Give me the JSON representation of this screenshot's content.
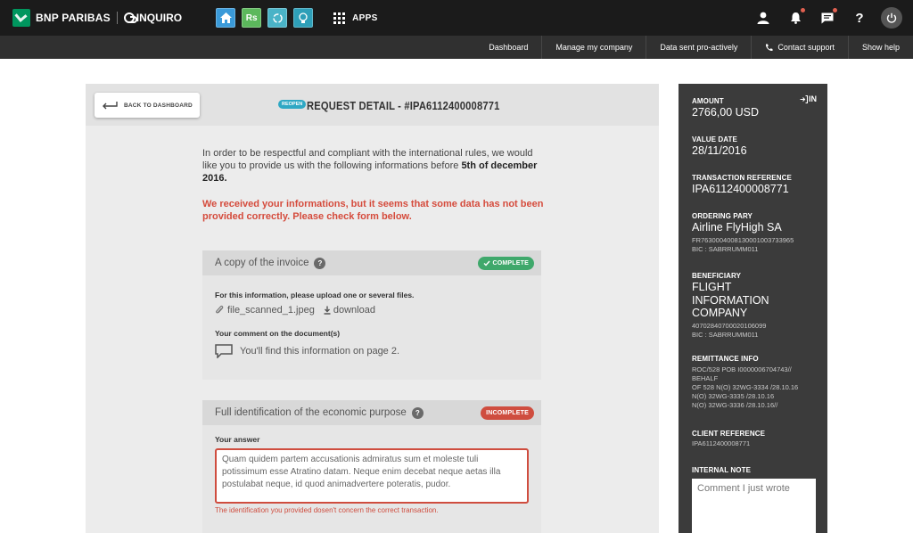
{
  "topbar": {
    "brand": "BNP PARIBAS",
    "product": "INQUIRO",
    "tiles": [
      {
        "name": "home-icon",
        "label": ""
      },
      {
        "name": "rs-app",
        "label": "Rs"
      },
      {
        "name": "recycle-icon",
        "label": ""
      },
      {
        "name": "bulb-icon",
        "label": ""
      }
    ],
    "apps_label": "APPS",
    "icons": [
      "user-icon",
      "bell-icon",
      "chat-icon",
      "help-icon",
      "power-icon"
    ]
  },
  "subnav": {
    "items": [
      "Dashboard",
      "Manage my company",
      "Data sent pro-actively",
      "Contact support",
      "Show help"
    ]
  },
  "header": {
    "back_label": "BACK TO DASHBOARD",
    "reopen_badge": "REOPEN",
    "title": "REQUEST DETAIL - #IPA6112400008771"
  },
  "intro": {
    "text": "In order to be respectful and compliant with the international rules, we would like you to provide us with the following informations before ",
    "deadline": "5th of december 2016."
  },
  "warning": "We received your informations, but it seems that some data has not been provided correctly. Please check form below.",
  "panel_invoice": {
    "title": "A copy of the invoice",
    "help": "?",
    "status": "COMPLETE",
    "instruction": "For this information, please upload one or several files.",
    "file_name": "file_scanned_1.jpeg",
    "download_label": "download",
    "comment_label": "Your comment on the document(s)",
    "comment": "You'll find this information on page 2."
  },
  "panel_purpose": {
    "title": "Full identification of the economic purpose",
    "help": "?",
    "status": "INCOMPLETE",
    "answer_label": "Your answer",
    "answer": "Quam quidem partem accusationis admiratus sum et moleste tuli potissimum esse Atratino datam. Neque enim decebat neque aetas illa postulabat neque, id quod animadvertere poteratis, pudor.",
    "error": "The identification you provided dosen't concern the correct transaction."
  },
  "side": {
    "login": "IN",
    "amount_label": "AMOUNT",
    "amount": "2766,00 USD",
    "value_date_label": "VALUE DATE",
    "value_date": "28/11/2016",
    "tx_ref_label": "TRANSACTION REFERENCE",
    "tx_ref": "IPA6112400008771",
    "ordering_label": "ORDERING PARY",
    "ordering_name": "Airline FlyHigh SA",
    "ordering_account": "FR7630004008130001003733965",
    "ordering_bic": "BIC : SABRRUMM011",
    "beneficiary_label": "BENEFICIARY",
    "beneficiary_name": "FLIGHT INFORMATION COMPANY",
    "beneficiary_account": "40702840700020106099",
    "beneficiary_bic": "BIC : SABRRUMM011",
    "remittance_label": "REMITTANCE INFO",
    "remittance_lines": [
      "ROC/528 POB I0000006704743//",
      "BEHALF",
      "OF 528 N(O) 32WG-3334 /28.10.16",
      "N(O) 32WG-3335 /28.10.16",
      "N(O) 32WG-3336 /28.10.16//"
    ],
    "client_ref_label": "CLIENT REFERENCE",
    "client_ref": "IPA6112400008771",
    "internal_note_label": "INTERNAL NOTE",
    "internal_note": "Comment I just wrote"
  },
  "colors": {
    "topbar": "#1b1b1b",
    "subnav": "#303030",
    "complete": "#3fa86b",
    "incomplete": "#cf4d3f",
    "reopen": "#2fa8c4",
    "side_panel": "#3b3b3b"
  }
}
